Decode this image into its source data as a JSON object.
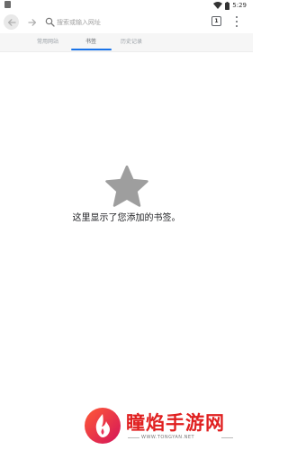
{
  "status_bar": {
    "time": "5:29",
    "icons": [
      "notification-icon",
      "wifi-icon",
      "battery-icon"
    ]
  },
  "toolbar": {
    "back_icon": "back-arrow-icon",
    "forward_icon": "forward-arrow-icon",
    "search": {
      "placeholder": "搜索或输入网址",
      "value": ""
    },
    "tab_count": "1",
    "menu_icon": "more-vert-icon"
  },
  "tabs": [
    {
      "label": "常用网站",
      "active": false
    },
    {
      "label": "书签",
      "active": true
    },
    {
      "label": "历史记录",
      "active": false
    }
  ],
  "empty_state": {
    "icon": "star-icon",
    "message": "这里显示了您添加的书签。"
  },
  "watermark": {
    "title": "瞳焰手游网",
    "url": "WWW.TONGYAN.NET"
  },
  "colors": {
    "accent": "#1a73e8",
    "star": "#9e9e9e",
    "watermark": "#e02020"
  }
}
